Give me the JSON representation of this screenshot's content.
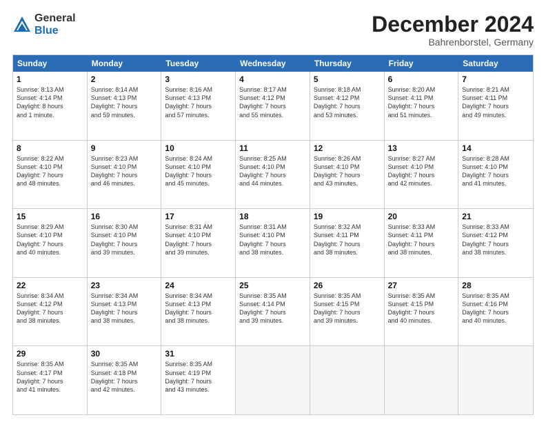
{
  "logo": {
    "general": "General",
    "blue": "Blue"
  },
  "title": "December 2024",
  "location": "Bahrenborstel, Germany",
  "days_of_week": [
    "Sunday",
    "Monday",
    "Tuesday",
    "Wednesday",
    "Thursday",
    "Friday",
    "Saturday"
  ],
  "weeks": [
    [
      {
        "day": "1",
        "text": "Sunrise: 8:13 AM\nSunset: 4:14 PM\nDaylight: 8 hours\nand 1 minute."
      },
      {
        "day": "2",
        "text": "Sunrise: 8:14 AM\nSunset: 4:13 PM\nDaylight: 7 hours\nand 59 minutes."
      },
      {
        "day": "3",
        "text": "Sunrise: 8:16 AM\nSunset: 4:13 PM\nDaylight: 7 hours\nand 57 minutes."
      },
      {
        "day": "4",
        "text": "Sunrise: 8:17 AM\nSunset: 4:12 PM\nDaylight: 7 hours\nand 55 minutes."
      },
      {
        "day": "5",
        "text": "Sunrise: 8:18 AM\nSunset: 4:12 PM\nDaylight: 7 hours\nand 53 minutes."
      },
      {
        "day": "6",
        "text": "Sunrise: 8:20 AM\nSunset: 4:11 PM\nDaylight: 7 hours\nand 51 minutes."
      },
      {
        "day": "7",
        "text": "Sunrise: 8:21 AM\nSunset: 4:11 PM\nDaylight: 7 hours\nand 49 minutes."
      }
    ],
    [
      {
        "day": "8",
        "text": "Sunrise: 8:22 AM\nSunset: 4:10 PM\nDaylight: 7 hours\nand 48 minutes."
      },
      {
        "day": "9",
        "text": "Sunrise: 8:23 AM\nSunset: 4:10 PM\nDaylight: 7 hours\nand 46 minutes."
      },
      {
        "day": "10",
        "text": "Sunrise: 8:24 AM\nSunset: 4:10 PM\nDaylight: 7 hours\nand 45 minutes."
      },
      {
        "day": "11",
        "text": "Sunrise: 8:25 AM\nSunset: 4:10 PM\nDaylight: 7 hours\nand 44 minutes."
      },
      {
        "day": "12",
        "text": "Sunrise: 8:26 AM\nSunset: 4:10 PM\nDaylight: 7 hours\nand 43 minutes."
      },
      {
        "day": "13",
        "text": "Sunrise: 8:27 AM\nSunset: 4:10 PM\nDaylight: 7 hours\nand 42 minutes."
      },
      {
        "day": "14",
        "text": "Sunrise: 8:28 AM\nSunset: 4:10 PM\nDaylight: 7 hours\nand 41 minutes."
      }
    ],
    [
      {
        "day": "15",
        "text": "Sunrise: 8:29 AM\nSunset: 4:10 PM\nDaylight: 7 hours\nand 40 minutes."
      },
      {
        "day": "16",
        "text": "Sunrise: 8:30 AM\nSunset: 4:10 PM\nDaylight: 7 hours\nand 39 minutes."
      },
      {
        "day": "17",
        "text": "Sunrise: 8:31 AM\nSunset: 4:10 PM\nDaylight: 7 hours\nand 39 minutes."
      },
      {
        "day": "18",
        "text": "Sunrise: 8:31 AM\nSunset: 4:10 PM\nDaylight: 7 hours\nand 38 minutes."
      },
      {
        "day": "19",
        "text": "Sunrise: 8:32 AM\nSunset: 4:11 PM\nDaylight: 7 hours\nand 38 minutes."
      },
      {
        "day": "20",
        "text": "Sunrise: 8:33 AM\nSunset: 4:11 PM\nDaylight: 7 hours\nand 38 minutes."
      },
      {
        "day": "21",
        "text": "Sunrise: 8:33 AM\nSunset: 4:12 PM\nDaylight: 7 hours\nand 38 minutes."
      }
    ],
    [
      {
        "day": "22",
        "text": "Sunrise: 8:34 AM\nSunset: 4:12 PM\nDaylight: 7 hours\nand 38 minutes."
      },
      {
        "day": "23",
        "text": "Sunrise: 8:34 AM\nSunset: 4:13 PM\nDaylight: 7 hours\nand 38 minutes."
      },
      {
        "day": "24",
        "text": "Sunrise: 8:34 AM\nSunset: 4:13 PM\nDaylight: 7 hours\nand 38 minutes."
      },
      {
        "day": "25",
        "text": "Sunrise: 8:35 AM\nSunset: 4:14 PM\nDaylight: 7 hours\nand 39 minutes."
      },
      {
        "day": "26",
        "text": "Sunrise: 8:35 AM\nSunset: 4:15 PM\nDaylight: 7 hours\nand 39 minutes."
      },
      {
        "day": "27",
        "text": "Sunrise: 8:35 AM\nSunset: 4:15 PM\nDaylight: 7 hours\nand 40 minutes."
      },
      {
        "day": "28",
        "text": "Sunrise: 8:35 AM\nSunset: 4:16 PM\nDaylight: 7 hours\nand 40 minutes."
      }
    ],
    [
      {
        "day": "29",
        "text": "Sunrise: 8:35 AM\nSunset: 4:17 PM\nDaylight: 7 hours\nand 41 minutes."
      },
      {
        "day": "30",
        "text": "Sunrise: 8:35 AM\nSunset: 4:18 PM\nDaylight: 7 hours\nand 42 minutes."
      },
      {
        "day": "31",
        "text": "Sunrise: 8:35 AM\nSunset: 4:19 PM\nDaylight: 7 hours\nand 43 minutes."
      },
      {
        "day": "",
        "text": ""
      },
      {
        "day": "",
        "text": ""
      },
      {
        "day": "",
        "text": ""
      },
      {
        "day": "",
        "text": ""
      }
    ]
  ]
}
